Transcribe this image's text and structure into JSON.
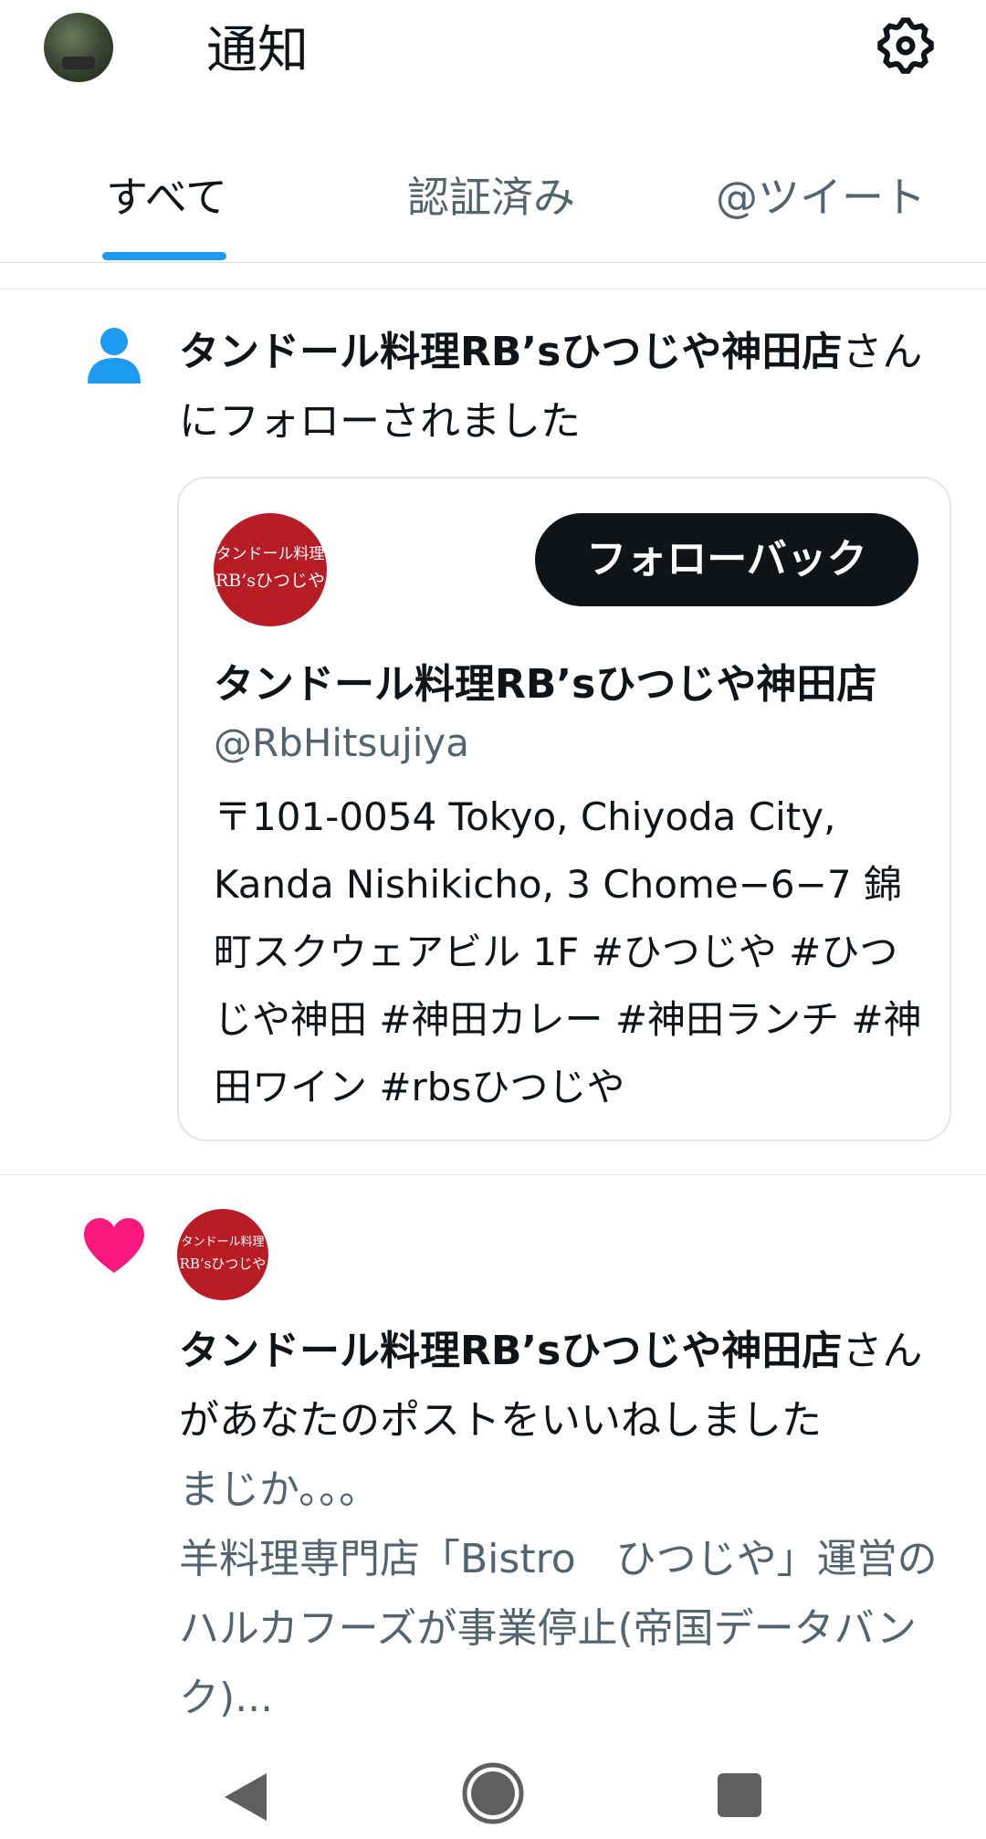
{
  "header": {
    "title": "通知",
    "avatar_icon": "user-avatar-photo",
    "settings_icon": "gear-icon"
  },
  "tabs": [
    {
      "label": "すべて",
      "active": true
    },
    {
      "label": "認証済み",
      "active": false
    },
    {
      "label": "@ツイート",
      "active": false
    }
  ],
  "colors": {
    "accent": "#1d9bf0",
    "like": "#f91880",
    "text_primary": "#0f1419",
    "text_secondary": "#536471",
    "avatar_red": "#b81c25"
  },
  "follow_notification": {
    "icon": "person-icon",
    "user_name": "タンドール料理RB’sひつじや神田店",
    "action_text": "さんにフォローされました",
    "card": {
      "avatar_line1": "タンドール料理",
      "avatar_line2": "RB’sひつじや",
      "follow_back_label": "フォローバック",
      "name": "タンドール料理RB’sひつじや神田店",
      "handle": "@RbHitsujiya",
      "bio": "〒101-0054 Tokyo, Chiyoda City, Kanda Nishikicho, 3 Chome−6−7 錦町スクウェアビル 1F #ひつじや #ひつじや神田 #神田カレー #神田ランチ #神田ワイン #rbsひつじや"
    }
  },
  "like_notification": {
    "icon": "heart-icon",
    "avatar_line1": "タンドール料理",
    "avatar_line2": "RB’sひつじや",
    "user_name": "タンドール料理RB’sひつじや神田店",
    "action_text": "さんがあなたのポストをいいねしました",
    "post_preview": "まじか。。。\n羊料理専門店「Bistro　ひつじや」運営のハルカフーズが事業停止(帝国データバンク)..."
  },
  "navbar": {
    "back_icon": "back-triangle-icon",
    "home_icon": "home-circle-icon",
    "recents_icon": "recents-square-icon"
  }
}
